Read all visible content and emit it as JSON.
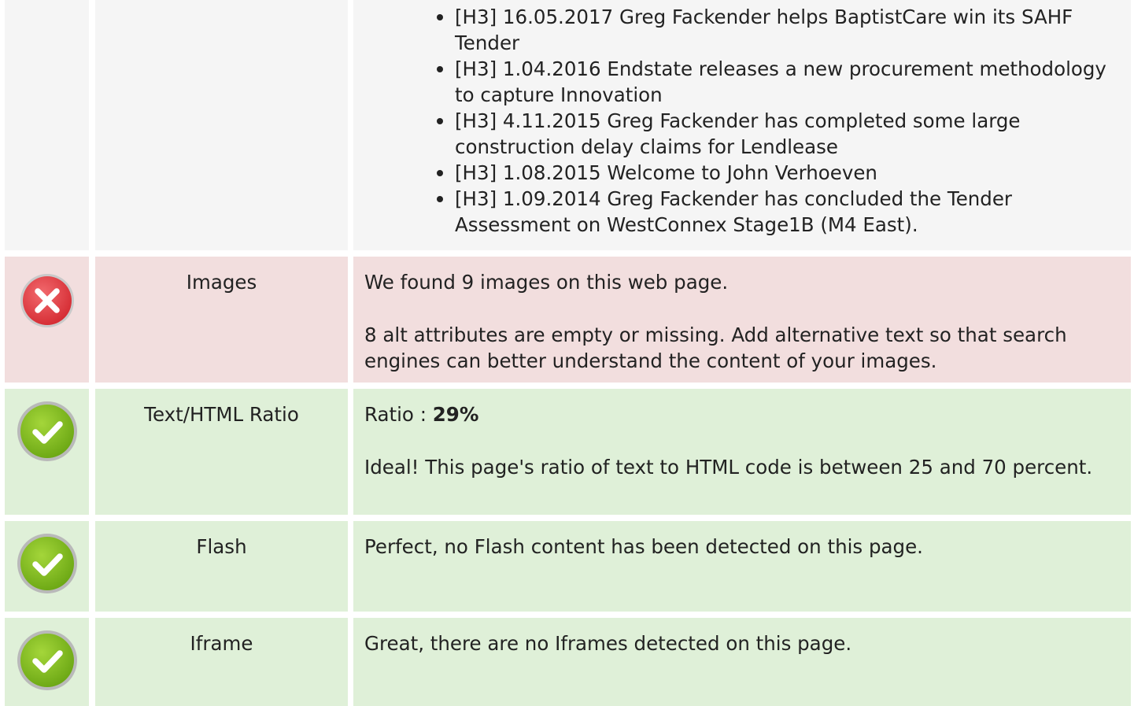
{
  "headings_row": {
    "items": [
      "[H3] 16.05.2017 Greg Fackender helps BaptistCare win its SAHF Tender",
      "[H3] 1.04.2016 Endstate releases a new procurement methodology to capture Innovation",
      "[H3] 4.11.2015 Greg Fackender has completed some large construction delay claims for Lendlease",
      "[H3] 1.08.2015 Welcome to John Verhoeven",
      "[H3] 1.09.2014 Greg Fackender has concluded the Tender Assessment on WestConnex Stage1B (M4 East)."
    ]
  },
  "images_row": {
    "status": "error",
    "status_icon": "error-x-icon",
    "label": "Images",
    "line1": "We found 9 images on this web page.",
    "line2": "8 alt attributes are empty or missing. Add alternative text so that search engines can better understand the content of your images."
  },
  "ratio_row": {
    "status": "success",
    "status_icon": "check-icon",
    "label": "Text/HTML Ratio",
    "ratio_prefix": "Ratio : ",
    "ratio_value": "29%",
    "line2": "Ideal! This page's ratio of text to HTML code is between 25 and 70 percent."
  },
  "flash_row": {
    "status": "success",
    "status_icon": "check-icon",
    "label": "Flash",
    "line1": "Perfect, no Flash content has been detected on this page."
  },
  "iframe_row": {
    "status": "success",
    "status_icon": "check-icon",
    "label": "Iframe",
    "line1": "Great, there are no Iframes detected on this page."
  },
  "colors": {
    "neutral_bg": "#f5f5f5",
    "error_bg": "#f2dede",
    "success_bg": "#dff0d8",
    "error_icon": "#e0383e",
    "success_icon": "#7ab51d"
  }
}
